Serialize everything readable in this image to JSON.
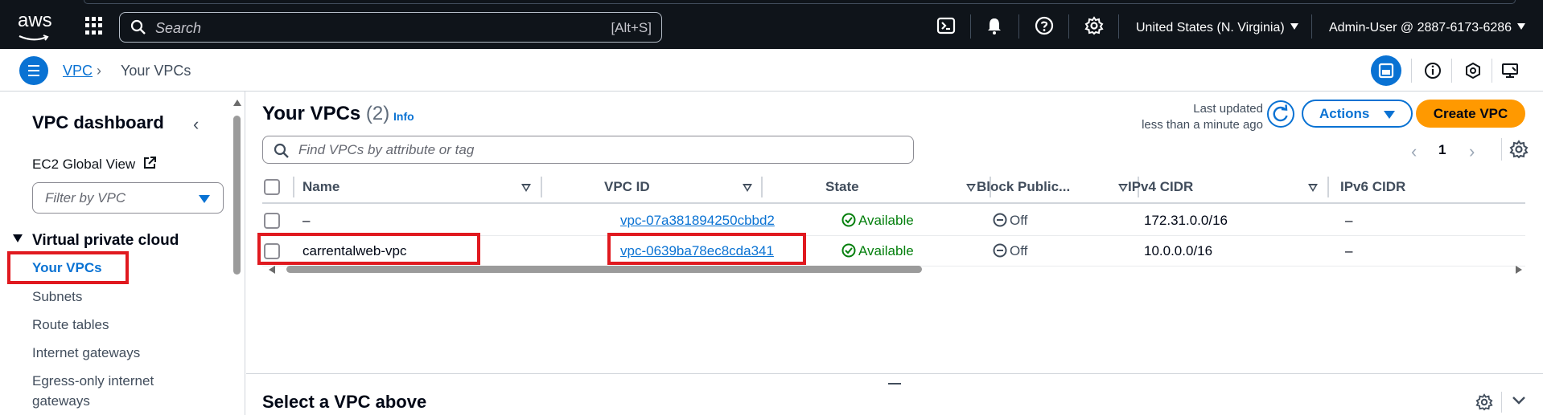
{
  "topnav": {
    "logo_text": "aws",
    "search_placeholder": "Search",
    "search_shortcut": "[Alt+S]",
    "region": "United States (N. Virginia)",
    "account": "Admin-User @ 2887-6173-6286"
  },
  "breadcrumb": {
    "service": "VPC",
    "current": "Your VPCs"
  },
  "sidebar": {
    "title": "VPC dashboard",
    "ec2_link": "EC2 Global View",
    "filter_placeholder": "Filter by VPC",
    "section": "Virtual private cloud",
    "items": [
      "Your VPCs",
      "Subnets",
      "Route tables",
      "Internet gateways",
      "Egress-only internet",
      "gateways"
    ]
  },
  "main": {
    "title": "Your VPCs",
    "count": "(2)",
    "info": "Info",
    "last_updated_label": "Last updated",
    "last_updated_value": "less than a minute ago",
    "actions_label": "Actions",
    "create_label": "Create VPC",
    "find_placeholder": "Find VPCs by attribute or tag",
    "page_number": "1",
    "columns": [
      "Name",
      "VPC ID",
      "State",
      "Block Public...",
      "IPv4 CIDR",
      "IPv6 CIDR"
    ],
    "rows": [
      {
        "name": "–",
        "vpc_id": "vpc-07a381894250cbbd2",
        "state": "Available",
        "block": "Off",
        "ipv4": "172.31.0.0/16",
        "ipv6": "–"
      },
      {
        "name": "carrentalweb-vpc",
        "vpc_id": "vpc-0639ba78ec8cda341",
        "state": "Available",
        "block": "Off",
        "ipv4": "10.0.0.0/16",
        "ipv6": "–"
      }
    ],
    "bottom_title": "Select a VPC above"
  },
  "colors": {
    "nav_bg": "#0f141a",
    "link_blue": "#0972d3",
    "primary_orange": "#ff9900",
    "success_green": "#037f0c",
    "highlight_red": "#e0191f"
  }
}
